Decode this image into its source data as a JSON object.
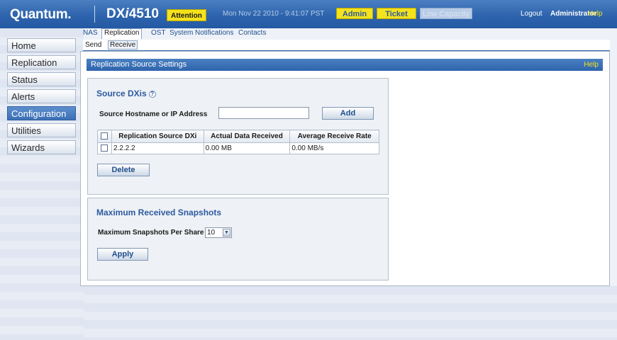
{
  "header": {
    "logo": "Quantum.",
    "model": "DX",
    "model_slash": "i",
    "model_number": "4510",
    "attention": "Attention",
    "datetime": "Mon Nov 22 2010 - 9:41:07 PST",
    "admin_label": "Admin",
    "ticket_label": "Ticket",
    "low_capacity_label": "Low Capacity",
    "logout_label": "Logout",
    "user": "Administrator",
    "help_label": "Help"
  },
  "nav": {
    "items": [
      {
        "label": "Home"
      },
      {
        "label": "Replication"
      },
      {
        "label": "Status"
      },
      {
        "label": "Alerts"
      },
      {
        "label": "Configuration"
      },
      {
        "label": "Utilities"
      },
      {
        "label": "Wizards"
      }
    ],
    "active": "Configuration"
  },
  "tabs": {
    "items": [
      "NAS",
      "Replication",
      "OST",
      "System",
      "Notifications",
      "Contacts"
    ],
    "active": "Replication"
  },
  "subtabs": {
    "items": [
      "Send",
      "Receive"
    ],
    "active": "Receive"
  },
  "panel": {
    "title": "Replication Source Settings",
    "help": "Help"
  },
  "source_dxis": {
    "title": "Source DXis",
    "help_icon": "question-icon",
    "hostname_label": "Source Hostname or IP Address",
    "hostname_value": "",
    "add_label": "Add",
    "columns": [
      "Replication Source DXi",
      "Actual Data Received",
      "Average Receive Rate"
    ],
    "rows": [
      {
        "source": "2.2.2.2",
        "received": "0.00 MB",
        "rate": "0.00 MB/s"
      }
    ],
    "delete_label": "Delete"
  },
  "snapshots": {
    "title": "Maximum Received Snapshots",
    "per_share_label": "Maximum Snapshots Per Share",
    "per_share_value": "10",
    "apply_label": "Apply"
  }
}
